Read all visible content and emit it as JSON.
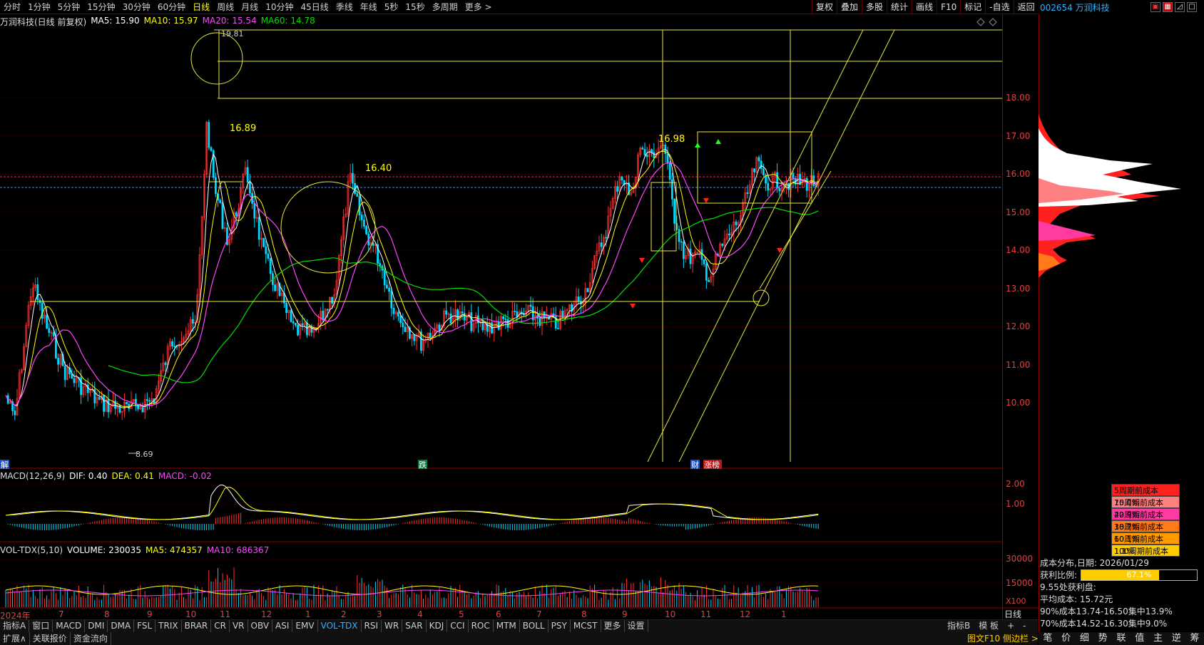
{
  "toolbar": {
    "periods": [
      "分时",
      "1分钟",
      "5分钟",
      "15分钟",
      "30分钟",
      "60分钟",
      "日线",
      "周线",
      "月线",
      "10分钟",
      "45日线",
      "季线",
      "年线",
      "5秒",
      "15秒",
      "多周期",
      "更多 >"
    ],
    "active_period": "日线",
    "right_tools": [
      "复权",
      "叠加",
      "多股",
      "统计",
      "画线",
      "F10",
      "标记",
      "-自选",
      "返回"
    ]
  },
  "stock": {
    "code_name": "002654 万润科技",
    "title": "万润科技(日线 前复权)"
  },
  "ma_legend": {
    "ma5": "MA5: 15.90",
    "ma10": "MA10: 15.97",
    "ma20": "MA20: 15.54",
    "ma60": "MA60: 14.78"
  },
  "macd_legend": {
    "name": "MACD(12,26,9)",
    "dif": "DIF: 0.40",
    "dea": "DEA: 0.41",
    "macd": "MACD: -0.02"
  },
  "vol_legend": {
    "name": "VOL-TDX(5,10)",
    "volume": "VOLUME: 230035",
    "ma5": "MA5: 474357",
    "ma10": "MA10: 686367"
  },
  "annotations": {
    "high_1": "19.81",
    "high_2": "16.89",
    "high_3": "16.40",
    "high_4": "16.98",
    "low_1": "8.69",
    "marker_die": "跌",
    "marker_cai": "财",
    "marker_zhangbang": "涨榜",
    "marker_left": "解"
  },
  "price_axis": [
    "18.00",
    "17.00",
    "16.00",
    "15.00",
    "14.00",
    "13.00",
    "12.00",
    "11.00",
    "10.00"
  ],
  "macd_axis": [
    "2.00",
    "1.00"
  ],
  "vol_axis": [
    "30000",
    "15000",
    "X100"
  ],
  "x_axis": [
    "2024年",
    "7",
    "8",
    "9",
    "10",
    "11",
    "12",
    "1",
    "2",
    "3",
    "4",
    "5",
    "6",
    "7",
    "8",
    "9",
    "10",
    "11",
    "12",
    "1"
  ],
  "x_axis_end": "日线",
  "indicator_tabs": [
    "指标A",
    "窗口",
    "MACD",
    "DMI",
    "DMA",
    "FSL",
    "TRIX",
    "BRAR",
    "CR",
    "VR",
    "OBV",
    "ASI",
    "EMV",
    "VOL-TDX",
    "RSI",
    "WR",
    "SAR",
    "KDJ",
    "CCI",
    "ROC",
    "MTM",
    "BOLL",
    "PSY",
    "MCST",
    "更多",
    "设置"
  ],
  "active_indicator": "VOL-TDX",
  "tabs_right": [
    "指标B",
    "模 板",
    "+",
    "-"
  ],
  "bottom_tabs": [
    "扩展∧",
    "关联报价",
    "资金流向"
  ],
  "bottom_right": "图文F10 侧边栏 >",
  "cost_legend": [
    {
      "label": "5周期前成本75.0%",
      "color": "#ff2020"
    },
    {
      "label": "10周期前成本42.9%",
      "color": "#ff8080"
    },
    {
      "label": "20周期前成本18.7%",
      "color": "#ff3aa0"
    },
    {
      "label": "30周期前成本10.1%",
      "color": "#ff7a1a"
    },
    {
      "label": "60周期前成本1.1%",
      "color": "#ff9a00"
    },
    {
      "label": "100周期前成本0.0%",
      "color": "#ffcc00"
    }
  ],
  "cost_info": {
    "date": "成本分布,日期: 2026/01/29",
    "profit_label": "获利比例:",
    "profit_value": "67.1%",
    "profit_pct": 0.671,
    "profit_at": "9.55处获利盘:",
    "avg_cost": "平均成本: 15.72元",
    "c90": "90%成本13.74-16.50集中13.9%",
    "c70": "70%成本14.52-16.30集中9.0%"
  },
  "sidebar_tabs": [
    "笔",
    "价",
    "细",
    "势",
    "联",
    "值",
    "主",
    "逆",
    "筹"
  ]
}
